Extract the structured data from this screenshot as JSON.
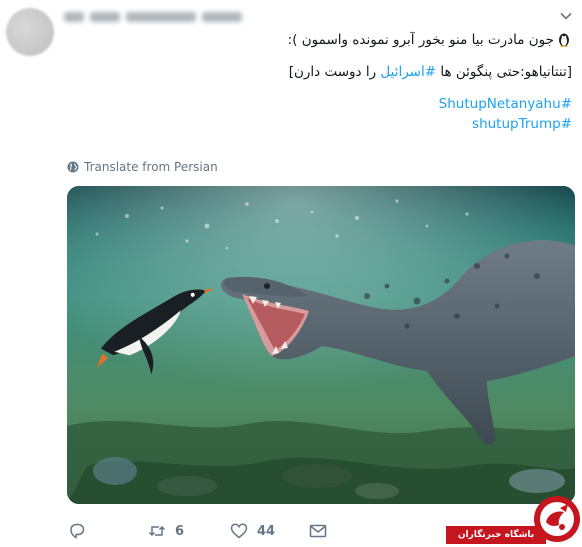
{
  "tweet": {
    "line1": "جون مادرت بیا منو بخور آبرو نمونده واسمون ):",
    "line2_prefix": "[تنتانیاهو:حتی پنگوئن ها ",
    "line2_hashtag": "#اسرائیل",
    "line2_suffix": " را دوست دارن]",
    "hashtag1": "#ShutupNetanyahu",
    "hashtag2": "#shutupTrump"
  },
  "translate": {
    "label": "Translate from Persian"
  },
  "actions": {
    "reply_count": "",
    "retweet_count": "6",
    "like_count": "44"
  },
  "watermark": {
    "text": "باشگاه خبرنگاران"
  },
  "icons": {
    "penguin": "penguin-emoji",
    "translate": "globe-icon",
    "reply": "reply-icon",
    "retweet": "retweet-icon",
    "like": "heart-icon",
    "dm": "envelope-icon",
    "menu": "chevron-down-icon"
  },
  "colors": {
    "link": "#1da1f2",
    "muted": "#657786",
    "brand_red": "#c5151f"
  }
}
